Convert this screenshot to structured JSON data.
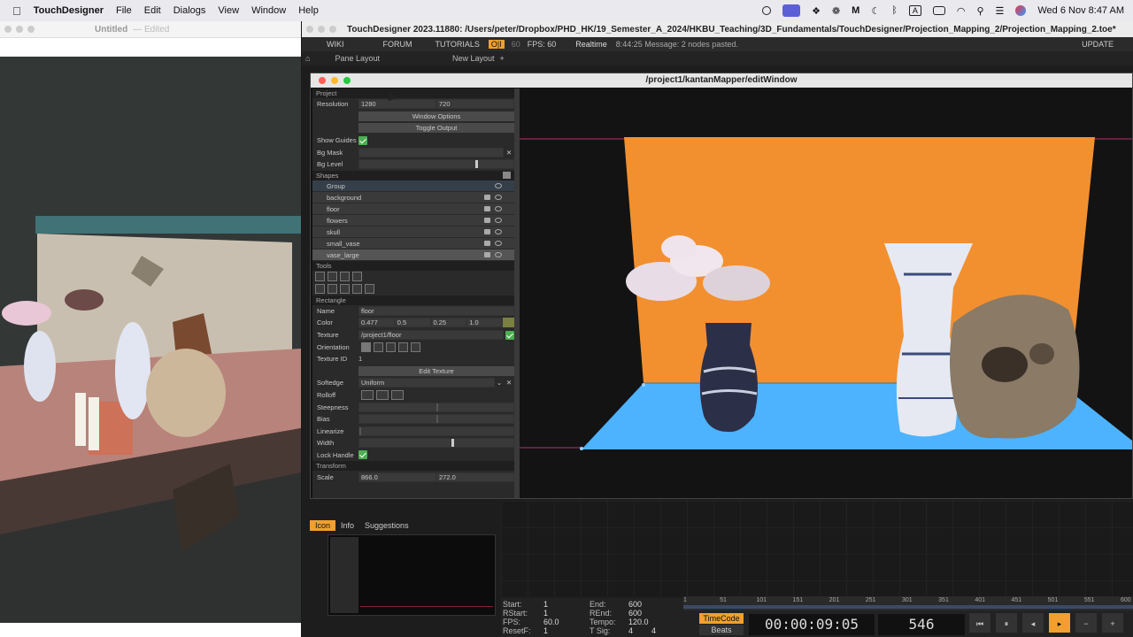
{
  "menubar": {
    "app": "TouchDesigner",
    "items": [
      "File",
      "Edit",
      "Dialogs",
      "View",
      "Window",
      "Help"
    ],
    "datetime": "Wed 6 Nov  8:47 AM",
    "input_source": "A"
  },
  "left_window": {
    "title": "Untitled",
    "subtitle": "— Edited"
  },
  "td": {
    "title": "TouchDesigner 2023.11880: /Users/peter/Dropbox/PHD_HK/19_Semester_A_2024/HKBU_Teaching/3D_Fundamentals/TouchDesigner/Projection_Mapping_2/Projection_Mapping_2.toe*",
    "bar1": {
      "wiki": "WIKI",
      "forum": "FORUM",
      "tutorials": "TUTORIALS",
      "badge": "O|I",
      "fps_label": "60",
      "fps": "FPS:  60",
      "realtime": "Realtime",
      "message": "8:44:25 Message: 2 nodes pasted.",
      "update": "UPDATE"
    },
    "bar2": {
      "pane_layout": "Pane Layout",
      "new_layout": "New Layout"
    }
  },
  "editwin": {
    "title": "/project1/kantanMapper/editWindow",
    "project_label": "Project",
    "resolution_label": "Resolution",
    "res_w": "1280",
    "res_h": "720",
    "window_options": "Window Options",
    "toggle_output": "Toggle Output",
    "show_guides": "Show Guides",
    "bg_mask": "Bg Mask",
    "bg_level": "Bg Level",
    "bg_level_value": 0.75,
    "shapes_label": "Shapes",
    "shapes": [
      "Group",
      "background",
      "floor",
      "flowers",
      "skull",
      "small_vase",
      "vase_large"
    ],
    "tools_label": "Tools",
    "rectangle_label": "Rectangle",
    "name_label": "Name",
    "name_value": "floor",
    "color_label": "Color",
    "color": [
      "0.477",
      "0.5",
      "0.25",
      "1.0"
    ],
    "texture_label": "Texture",
    "texture_value": "/project1/floor",
    "orientation_label": "Orientation",
    "textureid_label": "Texture ID",
    "textureid_value": "1",
    "edit_texture": "Edit Texture",
    "softedge_label": "Softedge",
    "softedge_value": "Uniform",
    "rolloff_label": "Rolloff",
    "steepness_label": "Steepness",
    "steepness_value": 0.5,
    "bias_label": "Bias",
    "bias_value": 0.5,
    "linearize_label": "Linearize",
    "linearize_value": 0,
    "width_label": "Width",
    "width_value": 0.6,
    "lockhandle_label": "Lock Handle",
    "transform_label": "Transform",
    "scale_label": "Scale",
    "scale_x": "866.0",
    "scale_y": "272.0"
  },
  "bottom": {
    "tabs": [
      "Icon",
      "Info",
      "Suggestions"
    ],
    "start_label": "Start:",
    "start": "1",
    "rstart_label": "RStart:",
    "rstart": "1",
    "fps_label": "FPS:",
    "fps": "60.0",
    "resetf_label": "ResetF:",
    "resetf": "1",
    "end_label": "End:",
    "end": "600",
    "rend_label": "REnd:",
    "rend": "600",
    "tempo_label": "Tempo:",
    "tempo": "120.0",
    "tsig_label": "T Sig:",
    "tsig_a": "4",
    "tsig_b": "4",
    "timecode_btn": "TimeCode",
    "beats_btn": "Beats",
    "timecode": "00:00:09:05",
    "frame": "546",
    "ruler": [
      "1",
      "51",
      "101",
      "151",
      "201",
      "251",
      "301",
      "351",
      "401",
      "451",
      "501",
      "551",
      "600"
    ]
  },
  "colors": {
    "orange": "#f29030",
    "blue": "#4db3ff",
    "accent": "#f0a030"
  }
}
